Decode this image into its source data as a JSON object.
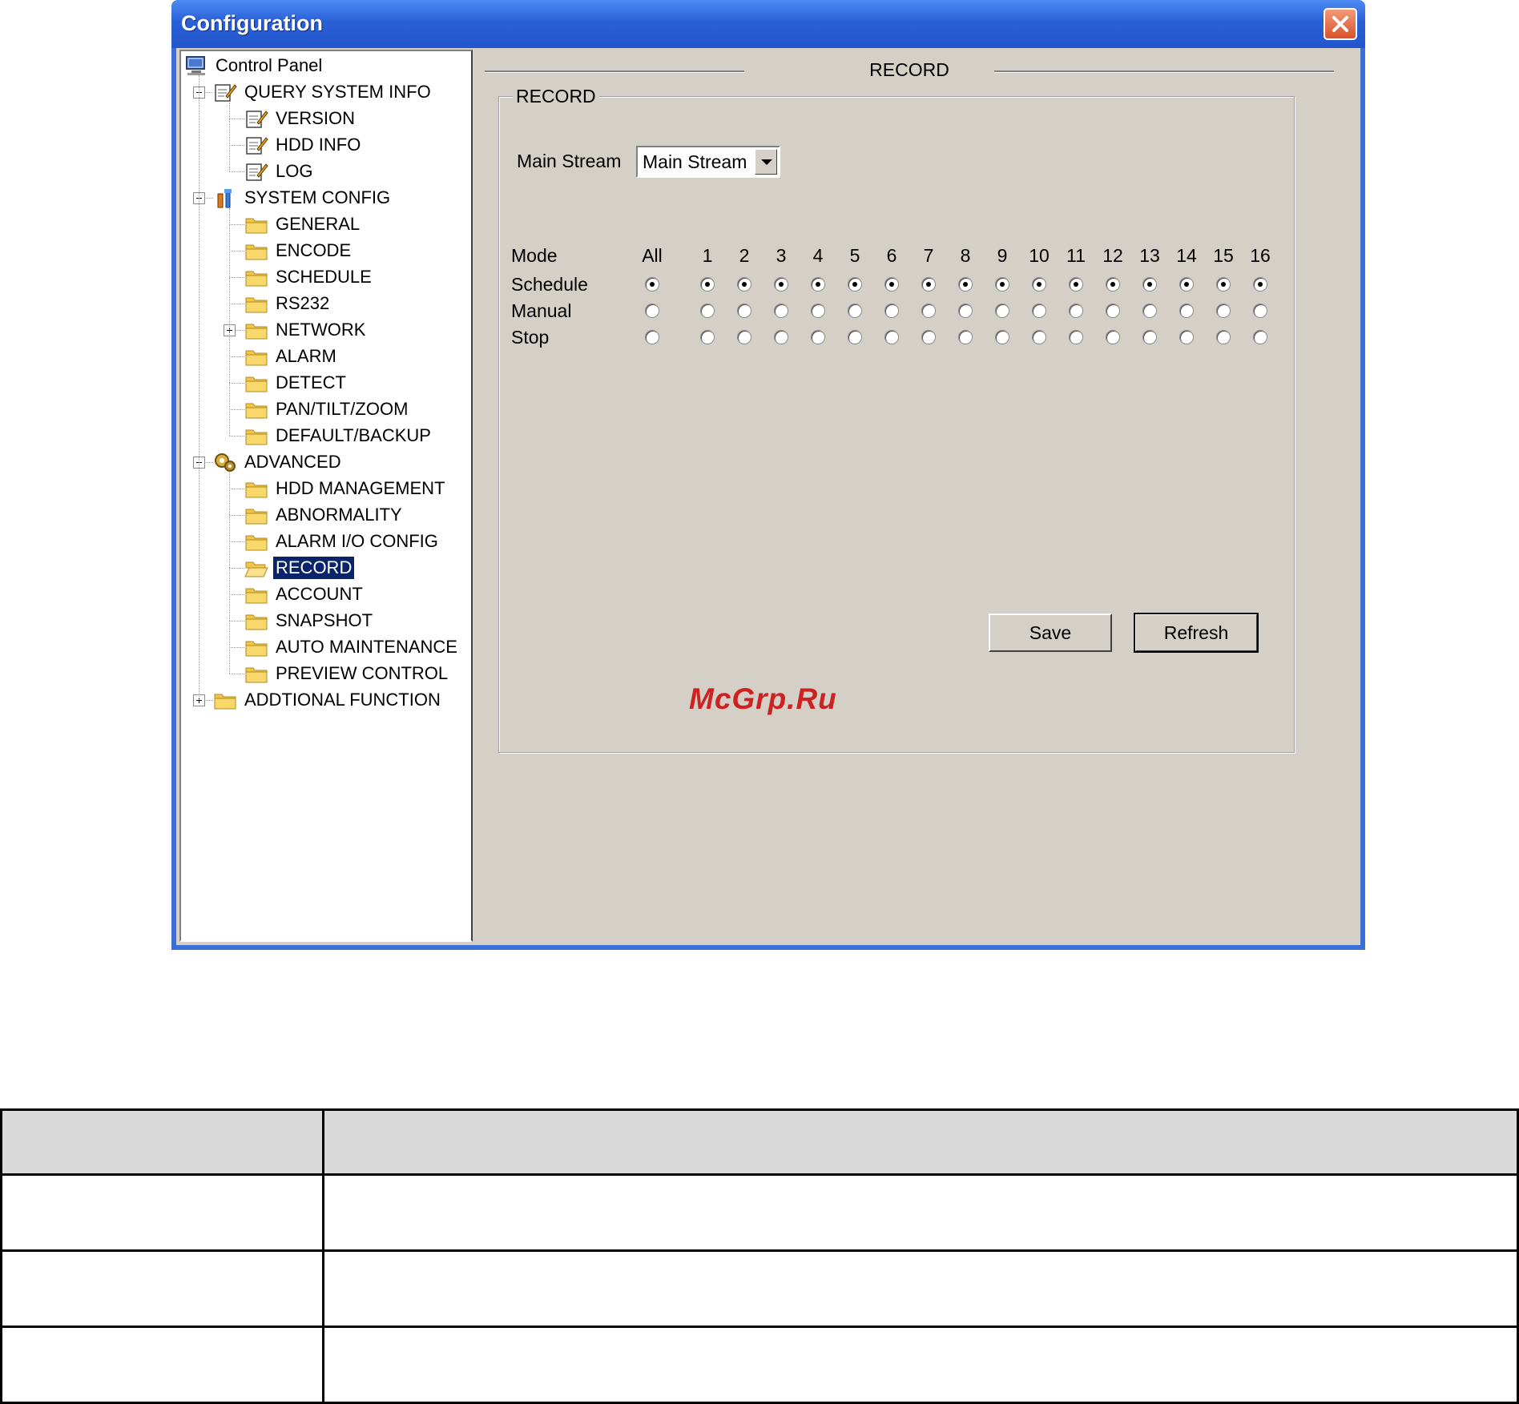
{
  "window": {
    "title": "Configuration"
  },
  "tree": {
    "root": "Control Panel",
    "items": [
      {
        "label": "QUERY SYSTEM INFO",
        "level": 1,
        "icon": "edit-icon",
        "expander": "minus"
      },
      {
        "label": "VERSION",
        "level": 2,
        "icon": "edit-icon"
      },
      {
        "label": "HDD INFO",
        "level": 2,
        "icon": "edit-icon"
      },
      {
        "label": "LOG",
        "level": 2,
        "icon": "edit-icon"
      },
      {
        "label": "SYSTEM CONFIG",
        "level": 1,
        "icon": "tools-icon",
        "expander": "minus"
      },
      {
        "label": "GENERAL",
        "level": 2,
        "icon": "folder-icon"
      },
      {
        "label": "ENCODE",
        "level": 2,
        "icon": "folder-icon"
      },
      {
        "label": "SCHEDULE",
        "level": 2,
        "icon": "folder-icon"
      },
      {
        "label": "RS232",
        "level": 2,
        "icon": "folder-icon"
      },
      {
        "label": "NETWORK",
        "level": 2,
        "icon": "folder-icon",
        "expander": "plus"
      },
      {
        "label": "ALARM",
        "level": 2,
        "icon": "folder-icon"
      },
      {
        "label": "DETECT",
        "level": 2,
        "icon": "folder-icon"
      },
      {
        "label": "PAN/TILT/ZOOM",
        "level": 2,
        "icon": "folder-icon"
      },
      {
        "label": "DEFAULT/BACKUP",
        "level": 2,
        "icon": "folder-icon"
      },
      {
        "label": "ADVANCED",
        "level": 1,
        "icon": "gears-icon",
        "expander": "minus"
      },
      {
        "label": "HDD MANAGEMENT",
        "level": 2,
        "icon": "folder-icon"
      },
      {
        "label": "ABNORMALITY",
        "level": 2,
        "icon": "folder-icon"
      },
      {
        "label": "ALARM I/O CONFIG",
        "level": 2,
        "icon": "folder-icon"
      },
      {
        "label": "RECORD",
        "level": 2,
        "icon": "folder-open-icon",
        "selected": true
      },
      {
        "label": "ACCOUNT",
        "level": 2,
        "icon": "folder-icon"
      },
      {
        "label": "SNAPSHOT",
        "level": 2,
        "icon": "folder-icon"
      },
      {
        "label": "AUTO MAINTENANCE",
        "level": 2,
        "icon": "folder-icon"
      },
      {
        "label": "PREVIEW CONTROL",
        "level": 2,
        "icon": "folder-icon"
      },
      {
        "label": "ADDTIONAL FUNCTION",
        "level": 1,
        "icon": "folder-icon",
        "expander": "plus"
      }
    ]
  },
  "panel": {
    "header": "RECORD",
    "group_title": "RECORD",
    "stream_label": "Main Stream",
    "stream_value": "Main Stream",
    "mode_label": "Mode",
    "columns": [
      "All",
      "1",
      "2",
      "3",
      "4",
      "5",
      "6",
      "7",
      "8",
      "9",
      "10",
      "11",
      "12",
      "13",
      "14",
      "15",
      "16"
    ],
    "modes": [
      "Schedule",
      "Manual",
      "Stop"
    ],
    "selected_mode": "Schedule",
    "save_label": "Save",
    "refresh_label": "Refresh"
  },
  "watermark": "McGrp.Ru",
  "doc_table": {
    "rows": 4,
    "header_row": true,
    "cells": [
      [
        "",
        ""
      ],
      [
        "",
        ""
      ],
      [
        "",
        ""
      ],
      [
        "",
        ""
      ]
    ]
  }
}
